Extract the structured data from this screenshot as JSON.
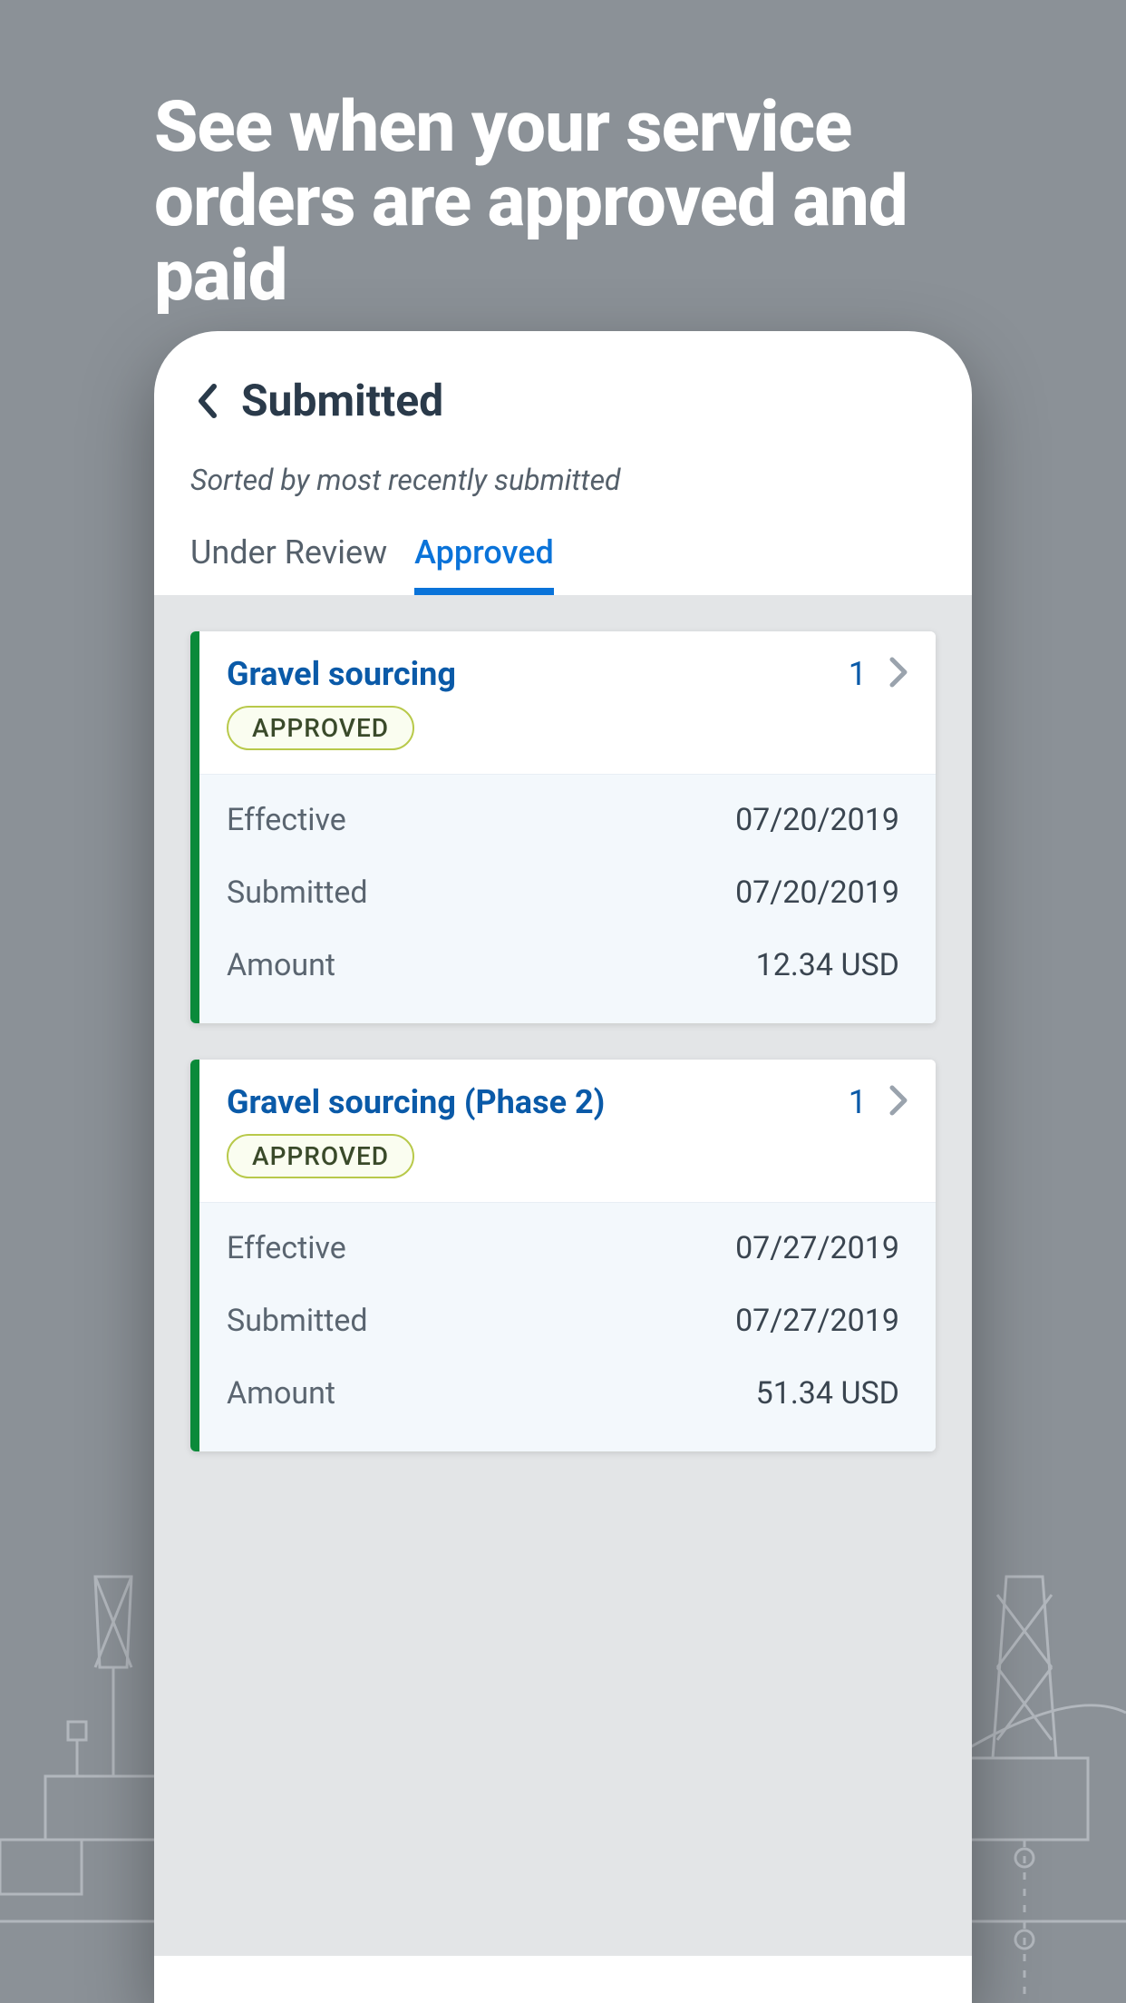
{
  "promo": {
    "title": "See when your service orders are approved and paid"
  },
  "header": {
    "title": "Submitted"
  },
  "sort_text": "Sorted by most recently submitted",
  "tabs": {
    "under_review": "Under Review",
    "approved": "Approved"
  },
  "labels": {
    "effective": "Effective",
    "submitted": "Submitted",
    "amount": "Amount"
  },
  "orders": [
    {
      "title": "Gravel sourcing",
      "count": "1",
      "status": "APPROVED",
      "effective": "07/20/2019",
      "submitted": "07/20/2019",
      "amount": "12.34 USD"
    },
    {
      "title": "Gravel sourcing (Phase 2)",
      "count": "1",
      "status": "APPROVED",
      "effective": "07/27/2019",
      "submitted": "07/27/2019",
      "amount": "51.34 USD"
    }
  ]
}
